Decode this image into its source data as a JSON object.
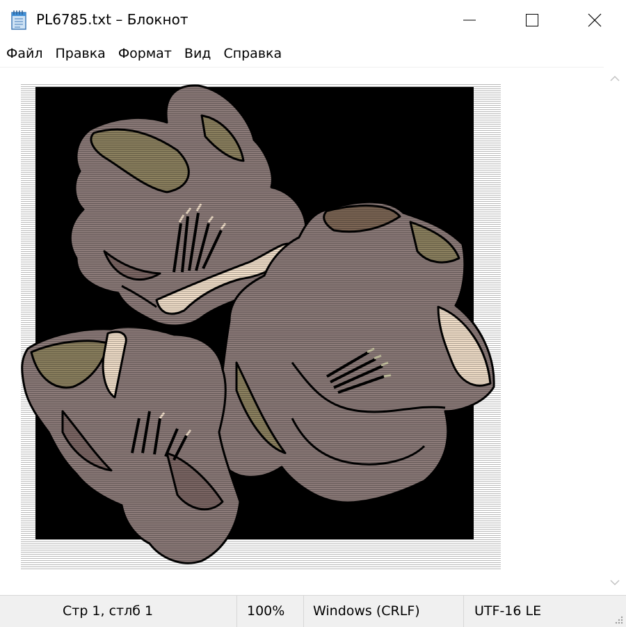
{
  "window": {
    "title": "PL6785.txt – Блокнот",
    "icon": "notepad-icon",
    "buttons": [
      "minimize-icon",
      "maximize-icon",
      "close-icon"
    ]
  },
  "menu": {
    "items": [
      {
        "label": "Файл"
      },
      {
        "label": "Правка"
      },
      {
        "label": "Формат"
      },
      {
        "label": "Вид"
      },
      {
        "label": "Справка"
      }
    ]
  },
  "editor": {
    "content_type": "ascii-art-flowers",
    "colors": {
      "background": "#000000",
      "petal": "#8b7a78",
      "petal_shade": "#7a6563",
      "olive": "#8a7f5e",
      "cream": "#eedcc7",
      "outline": "#000000"
    }
  },
  "scrollbar": {
    "up_icon": "chevron-up-icon",
    "down_icon": "chevron-down-icon"
  },
  "status": {
    "position": "Стр 1, стлб 1",
    "zoom": "100%",
    "line_endings": "Windows (CRLF)",
    "encoding": "UTF-16 LE"
  }
}
